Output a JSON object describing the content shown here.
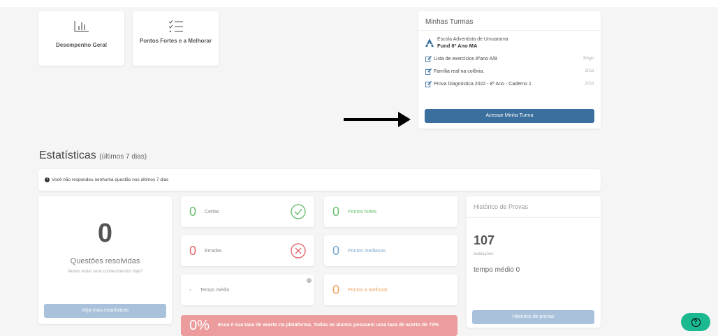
{
  "tiles": [
    {
      "label": "Desempenho Geral",
      "icon": "bar-chart-icon"
    },
    {
      "label": "Pontos Fortes e a Melhorar",
      "icon": "checklist-icon"
    }
  ],
  "turmas": {
    "title": "Minhas Turmas",
    "school_name": "Escola Adventista de Umuarama",
    "class_name": "Fund 8º Ano MA",
    "activities": [
      {
        "name": "Lista de exercícios 8ºano A/B",
        "date": "3/Ago"
      },
      {
        "name": "Família real na colônia.",
        "date": "2/Jul"
      },
      {
        "name": "Prova Diagnóstica 2022 - 8º Ano - Caderno 1",
        "date": "2/Jul"
      }
    ],
    "button_label": "Acessar Minha Turma"
  },
  "stats": {
    "title": "Estatísticas",
    "subtitle": "(últimos 7 dias)",
    "notice": "Você não respondeu nenhuma questão nos últimos 7 dias",
    "resolved_count": "0",
    "resolved_label": "Questões resolvidas",
    "resolved_sub": "Vamos testar seus conhecimentos hoje?",
    "more_button": "Veja mais estatísticas",
    "certas_value": "0",
    "certas_label": "Certas",
    "erradas_value": "0",
    "erradas_label": "Erradas",
    "tempo_value": "-",
    "tempo_label": "Tempo médio",
    "fortes_value": "0",
    "fortes_label": "Pontos fortes",
    "medianos_value": "0",
    "medianos_label": "Pontos medianos",
    "melhorar_value": "0",
    "melhorar_label": "Pontos a melhorar",
    "rate_value": "0%",
    "rate_text": "Essa é sua taxa de acerto na plataforma. Todos os alunos possuem uma taxa de acerto de 70%"
  },
  "history": {
    "title": "Histórico de Provas",
    "count": "107",
    "count_label": "avaliações",
    "time_label": "tempo médio 0",
    "button_label": "Histórico de provas"
  },
  "colors": {
    "primary": "#3a6f9e",
    "green": "#6cc070",
    "red": "#e2676b",
    "blue": "#7aa6cc",
    "orange": "#f0a35e",
    "help": "#1bb98f"
  }
}
